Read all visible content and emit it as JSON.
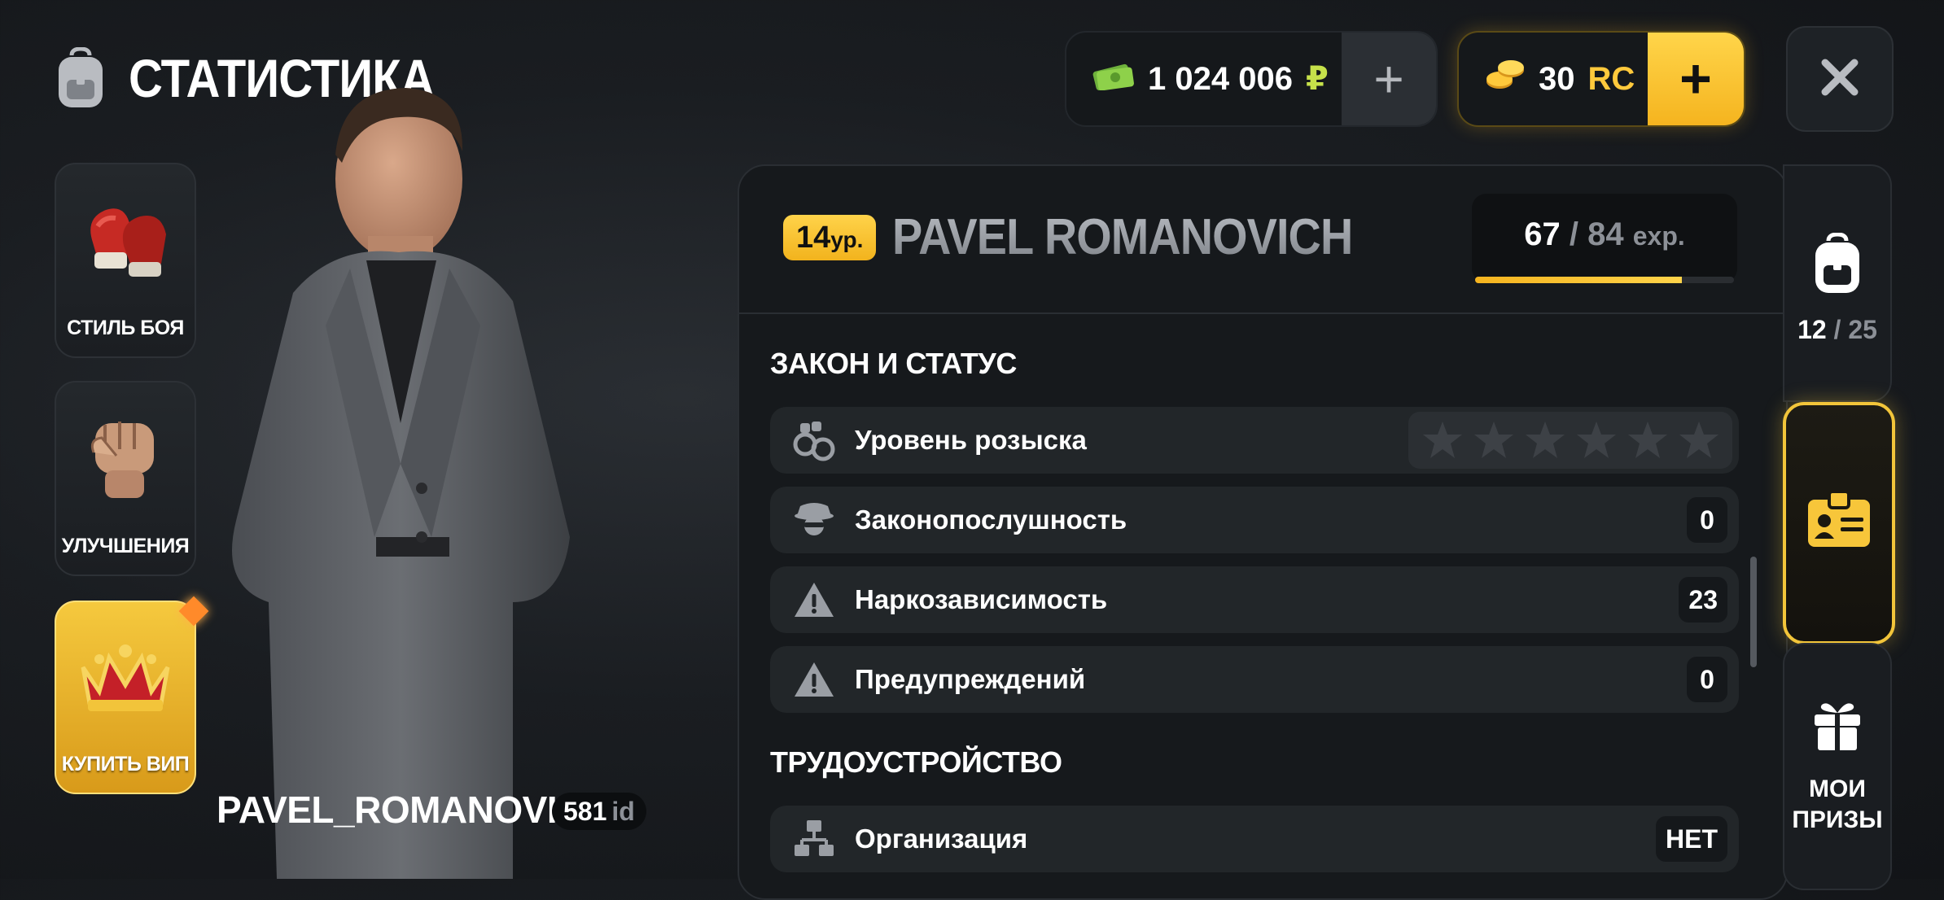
{
  "header": {
    "title": "СТАТИСТИКА",
    "rub_amount": "1 024 006",
    "rub_symbol": "₽",
    "rc_amount": "30",
    "rc_symbol": "RC",
    "plus": "+"
  },
  "left_menu": [
    {
      "label": "СТИЛЬ БОЯ",
      "icon": "boxing-gloves-icon"
    },
    {
      "label": "УЛУЧШЕНИЯ",
      "icon": "fist-icon"
    },
    {
      "label": "КУПИТЬ ВИП",
      "icon": "crown-icon"
    }
  ],
  "player": {
    "name": "PAVEL_ROMANOVICH",
    "id": "581",
    "id_suffix": "id"
  },
  "profile": {
    "level": "14",
    "level_unit": "ур.",
    "name": "PAVEL ROMANOVICH",
    "exp_current": "67",
    "exp_sep": "/",
    "exp_max": "84",
    "exp_unit": "exp.",
    "exp_progress": 0.8
  },
  "sections": {
    "law_title": "ЗАКОН И СТАТУС",
    "job_title": "ТРУДОУСТРОЙСТВО"
  },
  "rows": [
    {
      "label": "Уровень розыска",
      "icon": "handcuffs-icon",
      "stars_filled": 0,
      "stars_total": 6
    },
    {
      "label": "Законопослушность",
      "value": "0",
      "icon": "detective-icon"
    },
    {
      "label": "Наркозависимость",
      "value": "23",
      "icon": "warning-icon"
    },
    {
      "label": "Предупреждений",
      "value": "0",
      "icon": "warning-icon"
    },
    {
      "label": "Организация",
      "value": "НЕТ",
      "icon": "organization-icon"
    }
  ],
  "right_tabs": {
    "inventory_used": "12",
    "inventory_sep": "/",
    "inventory_total": "25",
    "prizes_line1": "МОИ",
    "prizes_line2": "ПРИЗЫ"
  },
  "colors": {
    "accent": "#f5b41f",
    "rub": "#c6e14a",
    "panel": "#16191c"
  }
}
